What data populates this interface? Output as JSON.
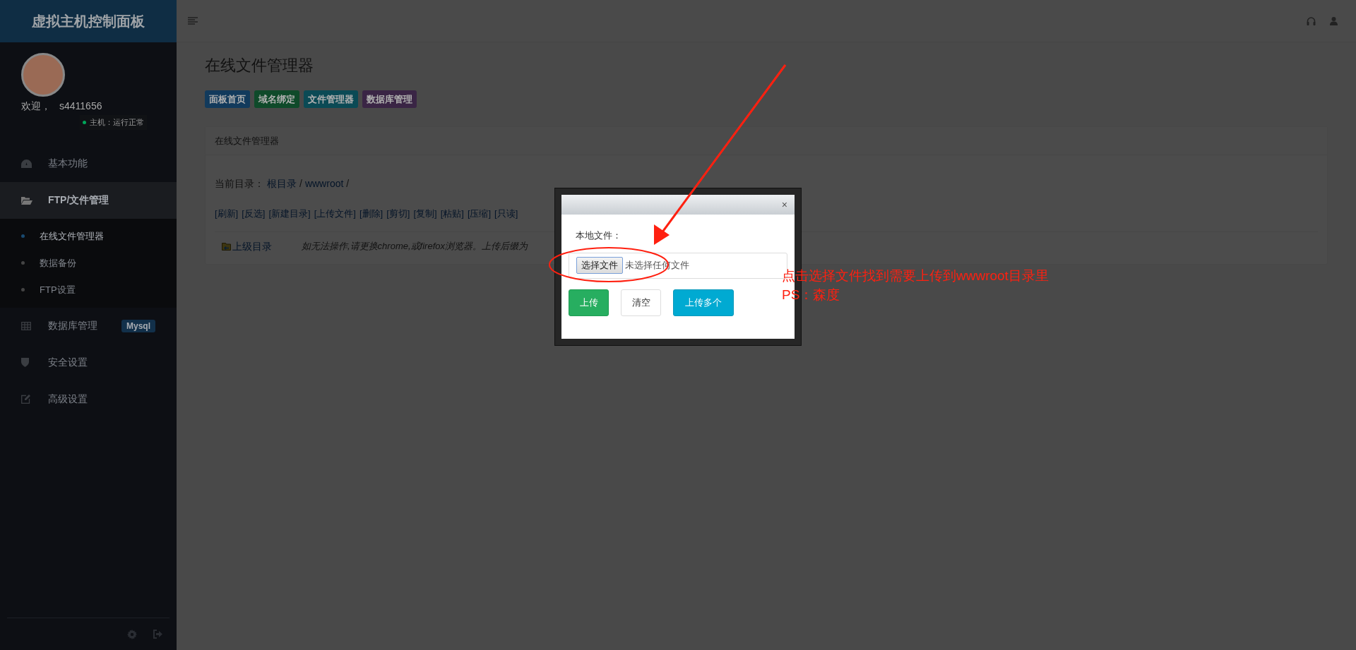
{
  "sidebar": {
    "brand": "虚拟主机控制面板",
    "welcome": "欢迎，",
    "username": "s4411656",
    "status": "主机：运行正常",
    "menu": [
      {
        "label": "基本功能",
        "selected": false
      },
      {
        "label": "FTP/文件管理",
        "selected": true,
        "expanded": true,
        "children": [
          {
            "label": "在线文件管理器",
            "selected": true
          },
          {
            "label": "数据备份",
            "selected": false
          },
          {
            "label": "FTP设置",
            "selected": false
          }
        ]
      },
      {
        "label": "数据库管理",
        "selected": false,
        "badge": "Mysql"
      },
      {
        "label": "安全设置",
        "selected": false
      },
      {
        "label": "高级设置",
        "selected": false
      }
    ]
  },
  "content": {
    "page_title": "在线文件管理器",
    "nav_buttons": [
      {
        "label": "面板首页",
        "color": "#123a5c"
      },
      {
        "label": "域名绑定",
        "color": "#0f4a2a"
      },
      {
        "label": "文件管理器",
        "color": "#0b4a55"
      },
      {
        "label": "数据库管理",
        "color": "#3a2545"
      }
    ],
    "panel": {
      "title": "在线文件管理器",
      "path_label": "当前目录：",
      "path": [
        {
          "kind": "link",
          "text": "根目录"
        },
        {
          "kind": "sep",
          "text": "/"
        },
        {
          "kind": "link",
          "text": "wwwroot"
        },
        {
          "kind": "sep",
          "text": "/"
        }
      ],
      "toolbar": [
        "[刷新]",
        "[反选]",
        "[新建目录]",
        "[上传文件]",
        "[删除]",
        "[剪切]",
        "[复制]",
        "[粘贴]",
        "[压缩]",
        "[只读]"
      ],
      "parent_dir": "上级目录",
      "hint": "如无法操作,请更换chrome,或firefox浏览器。上传后缀为"
    }
  },
  "modal": {
    "close": "×",
    "label": "本地文件：",
    "file_button": "选择文件",
    "file_status": "未选择任何文件",
    "buttons": [
      {
        "label": "上传",
        "kind": "success"
      },
      {
        "label": "清空",
        "kind": "default"
      },
      {
        "label": "上传多个",
        "kind": "info"
      }
    ]
  },
  "annotation": {
    "lines": [
      "点击选择文件找到需要上传到wwwroot目录里",
      "PS：森度"
    ]
  }
}
